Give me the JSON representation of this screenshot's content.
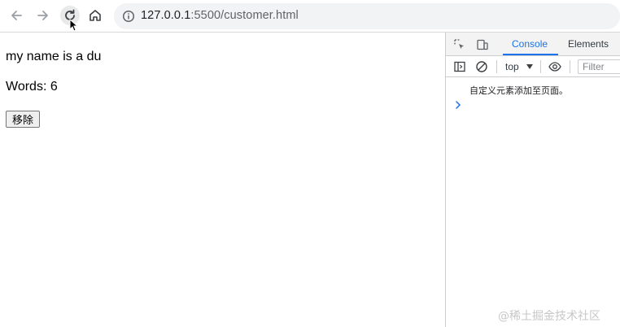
{
  "browser": {
    "url_host": "127.0.0.1",
    "url_rest": ":5500/customer.html"
  },
  "page": {
    "line1": "my name is a du",
    "line2": "Words: 6",
    "remove_button": "移除"
  },
  "devtools": {
    "tabs": [
      "Console",
      "Elements"
    ],
    "active_tab": "Console",
    "context": "top",
    "filter_placeholder": "Filter",
    "log": "自定义元素添加至页面。"
  },
  "watermark": "@稀土掘金技术社区",
  "colors": {
    "accent": "#1a73e8"
  }
}
